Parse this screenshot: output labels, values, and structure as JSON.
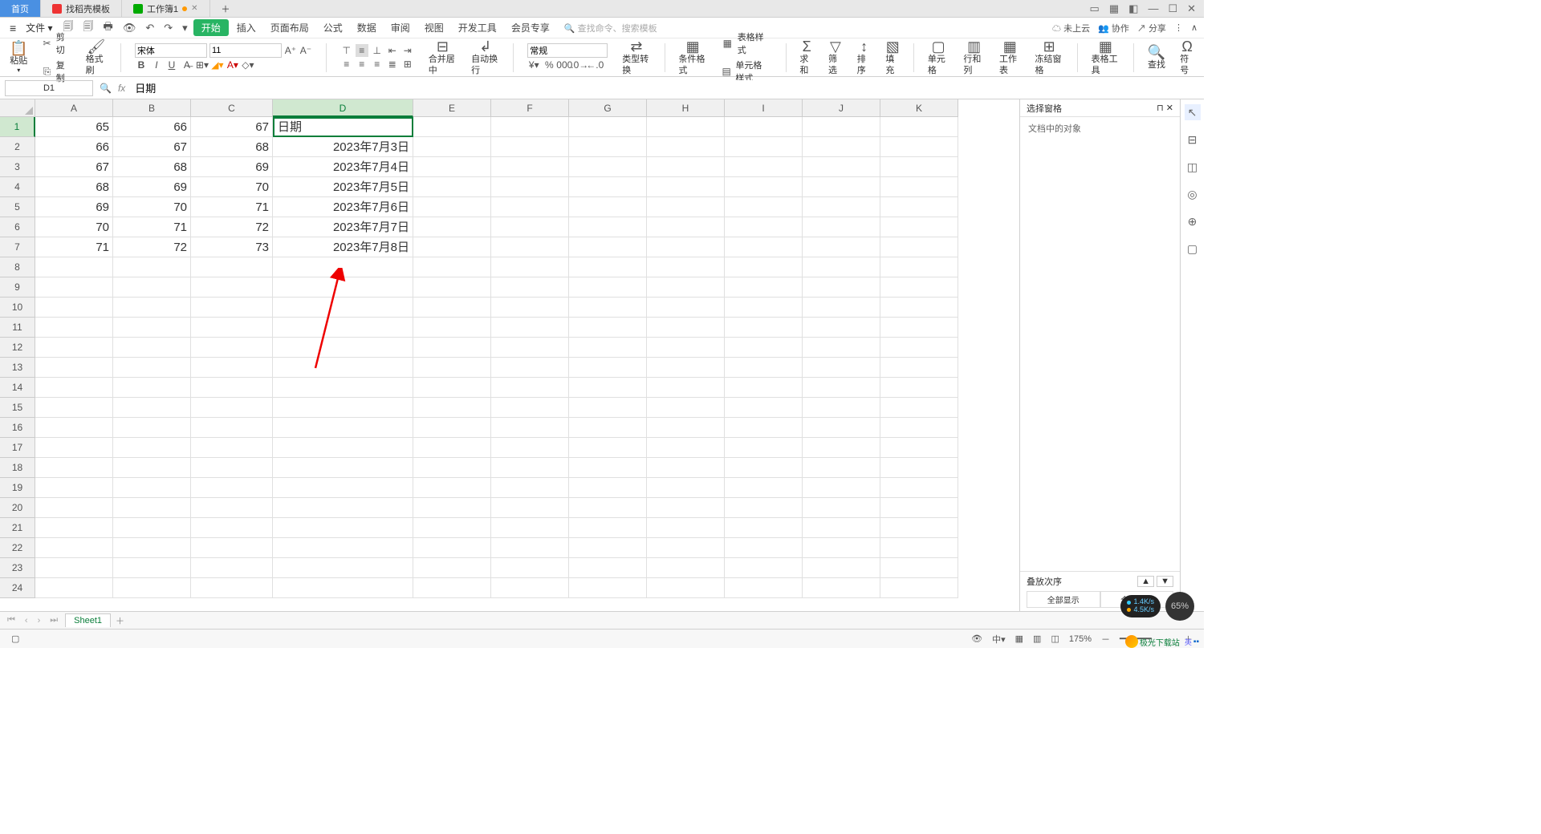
{
  "tabs": {
    "home": "首页",
    "template": "找稻壳模板",
    "workbook": "工作簿1"
  },
  "menu": {
    "file": "文件",
    "start": "开始",
    "insert": "插入",
    "pagelayout": "页面布局",
    "formula": "公式",
    "data": "数据",
    "review": "审阅",
    "view": "视图",
    "devtools": "开发工具",
    "member": "会员专享",
    "search_placeholder": "查找命令、搜索模板"
  },
  "menu_right": {
    "not_cloud": "未上云",
    "collab": "协作",
    "share": "分享"
  },
  "ribbon": {
    "paste": "粘贴",
    "cut": "剪切",
    "copy": "复制",
    "format_painter": "格式刷",
    "font": "宋体",
    "fontsize": "11",
    "merge_center": "合并居中",
    "auto_wrap": "自动换行",
    "number_format": "常规",
    "type_convert": "类型转换",
    "cond_format": "条件格式",
    "table_style": "表格样式",
    "cell_style": "单元格样式",
    "sum": "求和",
    "filter": "筛选",
    "sort": "排序",
    "fill": "填充",
    "cell": "单元格",
    "rowcol": "行和列",
    "worksheet": "工作表",
    "freeze": "冻结窗格",
    "table_tools": "表格工具",
    "find": "查找",
    "symbol": "符号"
  },
  "namebox": "D1",
  "formula_value": "日期",
  "columns": [
    "A",
    "B",
    "C",
    "D",
    "E",
    "F",
    "G",
    "H",
    "I",
    "J",
    "K"
  ],
  "selected_col": "D",
  "selected_row": 1,
  "grid": {
    "rows": [
      {
        "n": 1,
        "A": "65",
        "B": "66",
        "C": "67",
        "D": "日期"
      },
      {
        "n": 2,
        "A": "66",
        "B": "67",
        "C": "68",
        "D": "2023年7月3日"
      },
      {
        "n": 3,
        "A": "67",
        "B": "68",
        "C": "69",
        "D": "2023年7月4日"
      },
      {
        "n": 4,
        "A": "68",
        "B": "69",
        "C": "70",
        "D": "2023年7月5日"
      },
      {
        "n": 5,
        "A": "69",
        "B": "70",
        "C": "71",
        "D": "2023年7月6日"
      },
      {
        "n": 6,
        "A": "70",
        "B": "71",
        "C": "72",
        "D": "2023年7月7日"
      },
      {
        "n": 7,
        "A": "71",
        "B": "72",
        "C": "73",
        "D": "2023年7月8日"
      }
    ],
    "empty_rows": 24
  },
  "panel": {
    "title": "选择窗格",
    "subtitle": "文档中的对象",
    "stack_order": "叠放次序",
    "show_all": "全部显示",
    "hide_all": "全部隐藏"
  },
  "sheet": {
    "name": "Sheet1"
  },
  "status": {
    "zoom": "175%",
    "net_up": "1.4K/s",
    "net_dn": "4.5K/s",
    "pct": "65%",
    "brand": "极光下载站",
    "ime": "英"
  }
}
